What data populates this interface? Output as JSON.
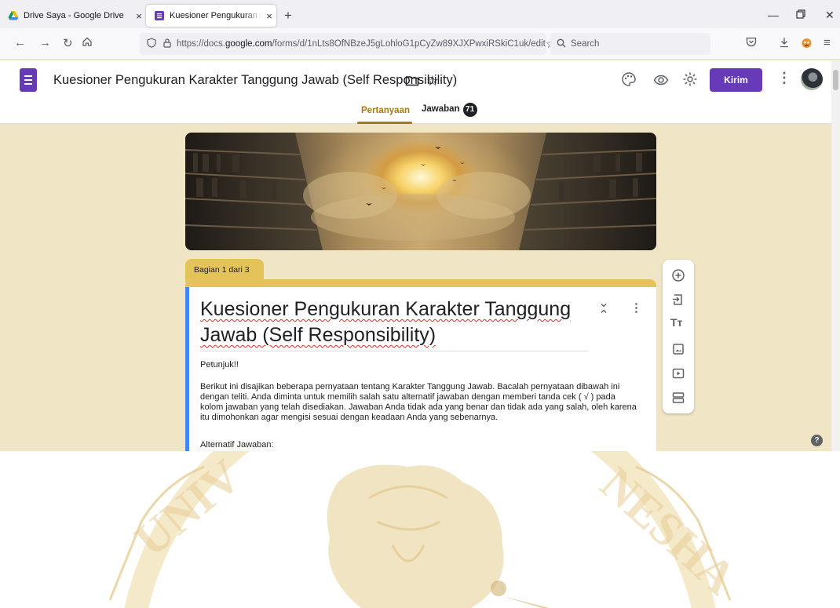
{
  "browser": {
    "tabs": [
      {
        "title": "Drive Saya - Google Drive",
        "active": false
      },
      {
        "title": "Kuesioner Pengukuran Karakter",
        "active": true
      }
    ],
    "new_tab": "+",
    "url_prefix": "https://docs.",
    "url_host": "google.com",
    "url_path": "/forms/d/1nLts8OfNBzeJ5gLohloG1pCyZw89XJXPwxiRSkiC1uk/edit",
    "search_placeholder": "Search"
  },
  "form_header": {
    "title": "Kuesioner Pengukuran Karakter Tanggung Jawab (Self Responsibility)",
    "send_label": "Kirim",
    "tabs": [
      {
        "label": "Pertanyaan",
        "active": true
      },
      {
        "label": "Jawaban",
        "count": "71",
        "active": false
      }
    ]
  },
  "section": {
    "label": "Bagian 1 dari 3",
    "title_line1": "Kuesioner Pengukuran Karakter Tanggung",
    "title_line2": "Jawab (Self Responsibility)",
    "instructions_heading": "Petunjuk!!",
    "description": "Berikut ini disajikan beberapa pernyataan tentang Karakter Tanggung Jawab. Bacalah pernyataan dibawah ini dengan teliti. Anda diminta untuk memilih salah satu alternatif jawaban dengan memberi tanda cek ( √ ) pada kolom jawaban yang telah disediakan. Jawaban Anda tidak ada yang benar dan tidak ada yang salah, oleh karena itu dimohonkan agar mengisi sesuai dengan keadaan Anda yang sebenarnya.",
    "alt_heading": "Alternatif Jawaban:"
  },
  "colors": {
    "theme_accent": "#e4c45a",
    "page_background": "#f0e6c6",
    "forms_purple": "#673ab7",
    "active_tab_text": "#a7791b",
    "left_bar": "#4285f4"
  },
  "icons": {
    "side_toolbar": [
      "add-question-icon",
      "import-questions-icon",
      "add-title-icon",
      "add-image-icon",
      "add-video-icon",
      "add-section-icon"
    ],
    "header": [
      "palette-icon",
      "preview-eye-icon",
      "settings-gear-icon"
    ]
  }
}
